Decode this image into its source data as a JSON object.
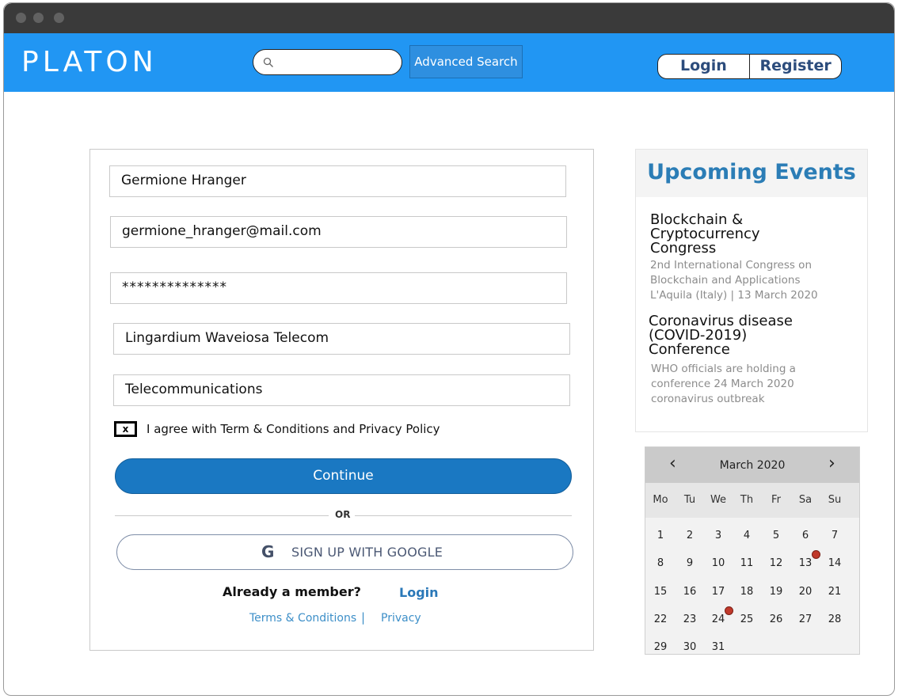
{
  "header": {
    "logo": "PLATON",
    "search": {
      "value": "",
      "placeholder": ""
    },
    "advanced_search": "Advanced Search",
    "login": "Login",
    "register": "Register"
  },
  "form": {
    "name": "Germione  Hranger",
    "email": "germione_hranger@mail.com",
    "password": "**************",
    "company": "Lingardium Waveiosa Telecom",
    "industry": "Telecommunications",
    "checkbox_mark": "x",
    "agree_text": "I agree with Term & Conditions and Privacy Policy",
    "continue": "Continue",
    "or": "OR",
    "google_g": "G",
    "google": "SIGN UP WITH GOOGLE",
    "already_member": "Already a member?",
    "login_link": "Login",
    "terms": "Terms & Conditions",
    "divider": "|",
    "privacy": "Privacy"
  },
  "events": {
    "title": "Upcoming Events",
    "items": [
      {
        "title": "Blockchain & Cryptocurrency Congress",
        "desc": "2nd International Congress on Blockchain and Applications L'Aquila (Italy) | 13 March 2020"
      },
      {
        "title": "Coronavirus disease (COVID-2019) Conference",
        "desc": "WHO officials are holding a conference 24 March 2020 coronavirus outbreak"
      }
    ]
  },
  "calendar": {
    "month": "March 2020",
    "prev": "‹",
    "next": "›",
    "weekdays": [
      "Mo",
      "Tu",
      "We",
      "Th",
      "Fr",
      "Sa",
      "Su"
    ],
    "days": [
      "1",
      "2",
      "3",
      "4",
      "5",
      "6",
      "7",
      "8",
      "9",
      "10",
      "11",
      "12",
      "13",
      "14",
      "15",
      "16",
      "17",
      "18",
      "19",
      "20",
      "21",
      "22",
      "23",
      "24",
      "25",
      "26",
      "27",
      "28",
      "29",
      "30",
      "31"
    ],
    "first_weekday_index": 0,
    "event_days": [
      "13",
      "24"
    ],
    "event_color": "#c0392b"
  },
  "colors": {
    "header": "#2196f3",
    "accent": "#2b7db6",
    "button": "#1a78c2"
  }
}
